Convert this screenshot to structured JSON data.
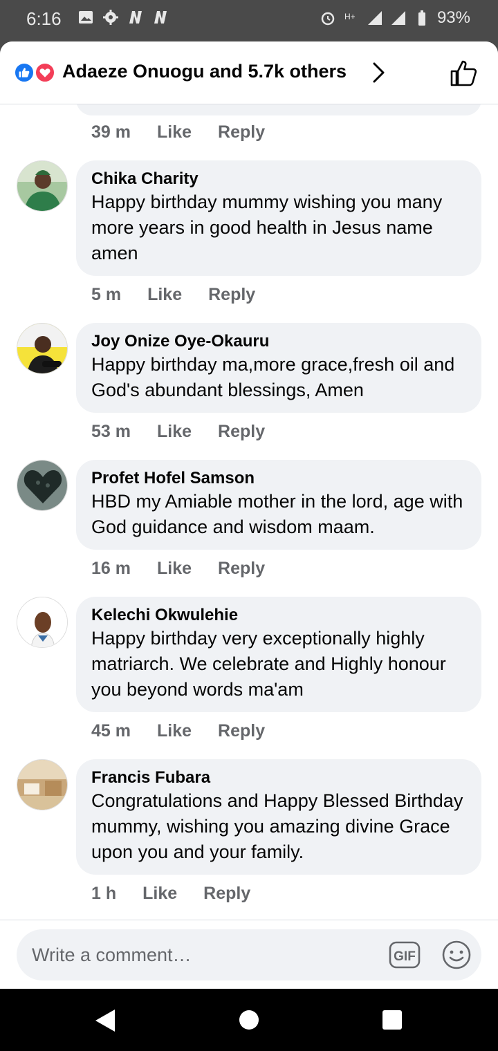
{
  "status_bar": {
    "time": "6:16",
    "battery": "93%",
    "icons": [
      "image-icon",
      "gear-icon",
      "n-icon",
      "n-icon",
      "alarm-icon",
      "hplus-icon",
      "signal-icon",
      "signal-icon",
      "battery-icon"
    ]
  },
  "header": {
    "title": "Adaeze Onuogu and 5.7k others",
    "reactions": [
      "like",
      "love"
    ],
    "colors": {
      "like": "#1877f2",
      "love": "#f33e58"
    }
  },
  "previous_comment": {
    "time": "39 m",
    "like": "Like",
    "reply": "Reply"
  },
  "comments": [
    {
      "name": "Chika Charity",
      "text": "Happy birthday mummy wishing you many more years in good health in Jesus name amen",
      "time": "5 m",
      "like": "Like",
      "reply": "Reply"
    },
    {
      "name": "Joy Onize Oye-Okauru",
      "text": "Happy birthday ma,more grace,fresh oil and God's abundant blessings, Amen",
      "time": "53 m",
      "like": "Like",
      "reply": "Reply"
    },
    {
      "name": "Profet Hofel Samson",
      "text": "HBD my Amiable mother in the lord, age with God guidance and wisdom maam.",
      "time": "16 m",
      "like": "Like",
      "reply": "Reply"
    },
    {
      "name": "Kelechi Okwulehie",
      "text": "Happy birthday very exceptionally highly matriarch. We celebrate and Highly honour you beyond words ma'am",
      "time": "45 m",
      "like": "Like",
      "reply": "Reply"
    },
    {
      "name": "Francis Fubara",
      "text": "Congratulations and Happy Blessed Birthday mummy, wishing you amazing divine Grace upon you and your family.",
      "time": "1 h",
      "like": "Like",
      "reply": "Reply"
    }
  ],
  "composer": {
    "placeholder": "Write a comment…",
    "gif_label": "GIF"
  }
}
